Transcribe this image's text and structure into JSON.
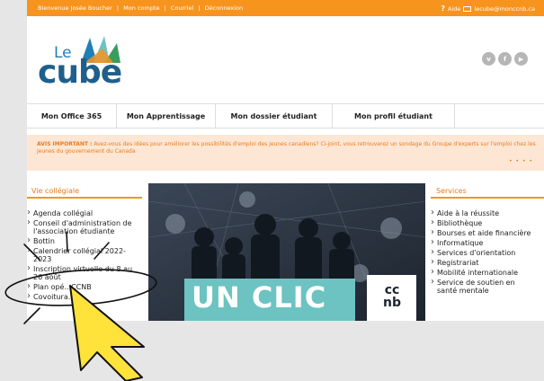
{
  "topbar": {
    "welcome": "Bienvenue Josée Boucher",
    "sep1": "|",
    "account": "Mon compte",
    "sep2": "|",
    "mail": "Courriel",
    "sep3": "|",
    "logout": "Déconnexion",
    "help_icon": "?",
    "help": "Aide",
    "email": "lecube@monccnb.ca"
  },
  "logo": {
    "le": "Le",
    "cube": "cube"
  },
  "social": [
    {
      "icon": "vimeo-icon",
      "glyph": "v"
    },
    {
      "icon": "facebook-icon",
      "glyph": "f"
    },
    {
      "icon": "youtube-icon",
      "glyph": "▶"
    }
  ],
  "nav": [
    "Mon Office 365",
    "Mon Apprentissage",
    "Mon dossier étudiant",
    "Mon profil étudiant"
  ],
  "notice": {
    "label": "AVIS IMPORTANT :",
    "text": " Avez-vous des idées pour améliorer les possibilités d'emploi des jeunes canadiens? Ci-joint, vous retrouverez un sondage du Groupe d'experts sur l'emploi chez les jeunes du gouvernement du Canada",
    "dots": "• • • •"
  },
  "left": {
    "title": "Vie collégiale",
    "items": [
      [
        "Agenda collégial",
        ""
      ],
      [
        "Conseil d'administration de",
        "l'association étudiante"
      ],
      [
        "Bottin",
        ""
      ],
      [
        "Calendrier collégial 2022-",
        "2023"
      ],
      [
        "Inscription virtuelle du 8 au",
        "26 août"
      ],
      [
        "Plan opé...CCNB",
        ""
      ],
      [
        "Covoitura...",
        ""
      ]
    ]
  },
  "right": {
    "title": "Services",
    "items": [
      [
        "Aide à la réussite",
        ""
      ],
      [
        "Bibliothèque",
        ""
      ],
      [
        "Bourses et aide financière",
        ""
      ],
      [
        "Informatique",
        ""
      ],
      [
        "Services d'orientation",
        ""
      ],
      [
        "Registrariat",
        ""
      ],
      [
        "Mobilité internationale",
        ""
      ],
      [
        "Service de soutien en",
        "santé mentale"
      ]
    ]
  },
  "banner": {
    "text": "UN CLIC",
    "brand": "cc nb"
  },
  "colors": {
    "orange": "#f7941e",
    "blue": "#1f5f8b",
    "teal": "#6cc3c1",
    "cursor": "#ffe23a"
  }
}
